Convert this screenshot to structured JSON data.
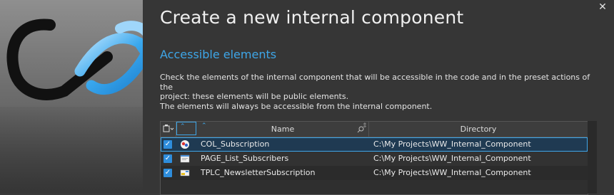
{
  "window": {
    "close_glyph": "✕"
  },
  "header": {
    "title": "Create a new internal component",
    "subtitle": "Accessible elements"
  },
  "description": {
    "line1": "Check the elements of the internal component that will be accessible in the code and in the preset actions of the",
    "line2": "project: these elements will be public elements.",
    "line3": "The elements will always be accessible from the internal component."
  },
  "table": {
    "columns": {
      "name": "Name",
      "directory": "Directory"
    },
    "rows": [
      {
        "name": "COL_Subscription",
        "directory": "C:\\My Projects\\WW_Internal_Component",
        "checked": true,
        "icon": "procedures-set-icon",
        "selected": true
      },
      {
        "name": "PAGE_List_Subscribers",
        "directory": "C:\\My Projects\\WW_Internal_Component",
        "checked": true,
        "icon": "page-icon",
        "selected": false
      },
      {
        "name": "TPLC_NewsletterSubscription",
        "directory": "C:\\My Projects\\WW_Internal_Component",
        "checked": true,
        "icon": "control-template-icon",
        "selected": false
      }
    ]
  },
  "colors": {
    "accent": "#3ea6e8",
    "background": "#363636",
    "checkbox": "#2e8ddc"
  }
}
